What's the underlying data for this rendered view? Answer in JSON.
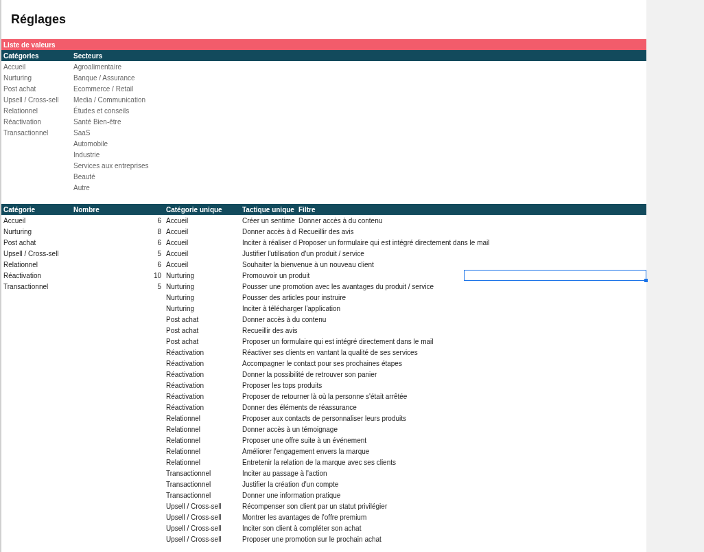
{
  "page_title": "Réglages",
  "value_list": {
    "title": "Liste de valeurs",
    "columns": [
      "Catégories",
      "Secteurs"
    ],
    "categories": [
      "Accueil",
      "Nurturing",
      "Post achat",
      "Upsell / Cross-sell",
      "Relationnel",
      "Réactivation",
      "Transactionnel"
    ],
    "sectors": [
      "Agroalimentaire",
      "Banque / Assurance",
      "Ecommerce / Retail",
      "Media / Communication",
      "Études et conseils",
      "Santé Bien-être",
      "SaaS",
      "Automobile",
      "Industrie",
      "Services aux entreprises",
      "Beauté",
      "Autre"
    ]
  },
  "summary": {
    "columns": [
      "Catégorie",
      "Nombre",
      "Catégorie unique",
      "Tactique unique",
      "Filtre"
    ],
    "rows": [
      {
        "category": "Accueil",
        "count": "6",
        "unique_category": "Accueil",
        "tactic": "Créer un sentime",
        "filter": "Donner accès à du contenu",
        "selected": false
      },
      {
        "category": "Nurturing",
        "count": "8",
        "unique_category": "Accueil",
        "tactic": "Donner accès à d",
        "filter": "Recueillir des avis",
        "selected": false
      },
      {
        "category": "Post achat",
        "count": "6",
        "unique_category": "Accueil",
        "tactic": "Inciter à réaliser d",
        "filter": "Proposer un formulaire qui est intégré directement dans le mail",
        "selected": false
      },
      {
        "category": "Upsell / Cross-sell",
        "count": "5",
        "unique_category": "Accueil",
        "tactic": "Justifier l'utilisation d'un produit / service",
        "selected": false
      },
      {
        "category": "Relationnel",
        "count": "6",
        "unique_category": "Accueil",
        "tactic": "Souhaiter la bienvenue à un nouveau client",
        "selected": false
      },
      {
        "category": "Réactivation",
        "count": "10",
        "unique_category": "Nurturing",
        "tactic": "Promouvoir un produit",
        "selected": true
      },
      {
        "category": "Transactionnel",
        "count": "5",
        "unique_category": "Nurturing",
        "tactic": "Pousser une promotion avec les avantages du produit / service",
        "selected": false
      },
      {
        "unique_category": "Nurturing",
        "tactic": "Pousser des articles pour instruire",
        "selected": false
      },
      {
        "unique_category": "Nurturing",
        "tactic": "Inciter à télécharger l'application",
        "selected": false
      },
      {
        "unique_category": "Post achat",
        "tactic": "Donner accès à du contenu",
        "selected": false
      },
      {
        "unique_category": "Post achat",
        "tactic": "Recueillir des avis",
        "selected": false
      },
      {
        "unique_category": "Post achat",
        "tactic": "Proposer un formulaire qui est intégré directement dans le mail",
        "selected": false
      },
      {
        "unique_category": "Réactivation",
        "tactic": "Réactiver ses clients en vantant la qualité de ses services",
        "selected": false
      },
      {
        "unique_category": "Réactivation",
        "tactic": "Accompagner le contact pour ses prochaines étapes",
        "selected": false
      },
      {
        "unique_category": "Réactivation",
        "tactic": "Donner la possibilité de retrouver son panier",
        "selected": false
      },
      {
        "unique_category": "Réactivation",
        "tactic": "Proposer les tops produits",
        "selected": false
      },
      {
        "unique_category": "Réactivation",
        "tactic": "Proposer de retourner là où la personne s'était arrêtée",
        "selected": false
      },
      {
        "unique_category": "Réactivation",
        "tactic": "Donner des éléments de réassurance",
        "selected": false
      },
      {
        "unique_category": "Relationnel",
        "tactic": "Proposer aux contacts de personnaliser leurs produits",
        "selected": false
      },
      {
        "unique_category": "Relationnel",
        "tactic": "Donner accès à un témoignage",
        "selected": false
      },
      {
        "unique_category": "Relationnel",
        "tactic": "Proposer une offre suite à un événement",
        "selected": false
      },
      {
        "unique_category": "Relationnel",
        "tactic": "Améliorer l'engagement envers la marque",
        "selected": false
      },
      {
        "unique_category": "Relationnel",
        "tactic": "Entretenir la relation de la marque avec ses clients",
        "selected": false
      },
      {
        "unique_category": "Transactionnel",
        "tactic": "Inciter au passage à l'action",
        "selected": false
      },
      {
        "unique_category": "Transactionnel",
        "tactic": "Justifier la création d'un compte",
        "selected": false
      },
      {
        "unique_category": "Transactionnel",
        "tactic": "Donner une information pratique",
        "selected": false
      },
      {
        "unique_category": "Upsell / Cross-sell",
        "tactic": "Récompenser son client par un statut privilégier",
        "selected": false
      },
      {
        "unique_category": "Upsell / Cross-sell",
        "tactic": "Montrer les avantages de l'offre premium",
        "selected": false
      },
      {
        "unique_category": "Upsell / Cross-sell",
        "tactic": "Inciter son client à compléter son achat",
        "selected": false
      },
      {
        "unique_category": "Upsell / Cross-sell",
        "tactic": "Proposer une promotion sur le prochain achat",
        "selected": false
      }
    ]
  }
}
